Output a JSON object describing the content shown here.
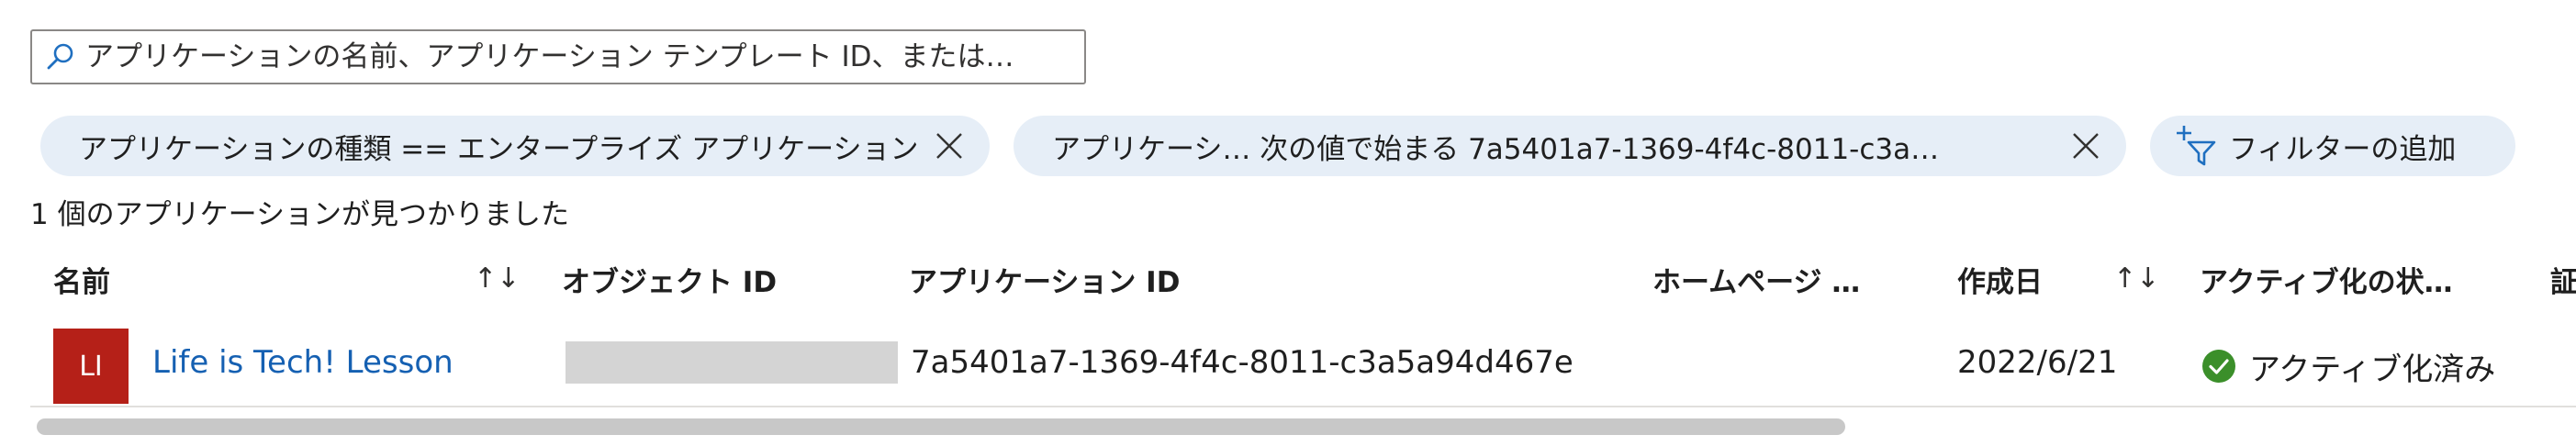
{
  "search": {
    "placeholder": "アプリケーションの名前、アプリケーション テンプレート ID、または…"
  },
  "filters": [
    {
      "label": "アプリケーションの種類 == エンタープライズ アプリケーション"
    },
    {
      "label": "アプリケーシ… 次の値で始まる 7a5401a7-1369-4f4c-8011-c3a…"
    }
  ],
  "add_filter": {
    "label": "フィルターの追加"
  },
  "result_count": "1 個のアプリケーションが見つかりました",
  "table": {
    "headers": {
      "name": "名前",
      "object_id": "オブジェクト ID",
      "app_id": "アプリケーション ID",
      "homepage": "ホームページ …",
      "created": "作成日",
      "status": "アクティブ化の状…",
      "extra": "証"
    },
    "sort_glyph": "↑↓",
    "rows": [
      {
        "avatar": "LI",
        "name": "Life is Tech! Lesson",
        "app_id": "7a5401a7-1369-4f4c-8011-c3a5a94d467e",
        "created": "2022/6/21",
        "status": "アクティブ化済み"
      }
    ]
  },
  "colors": {
    "pill_bg": "#e6eef7",
    "avatar_bg": "#b52018",
    "link": "#1560b2",
    "status_ok": "#3b8f2a"
  }
}
